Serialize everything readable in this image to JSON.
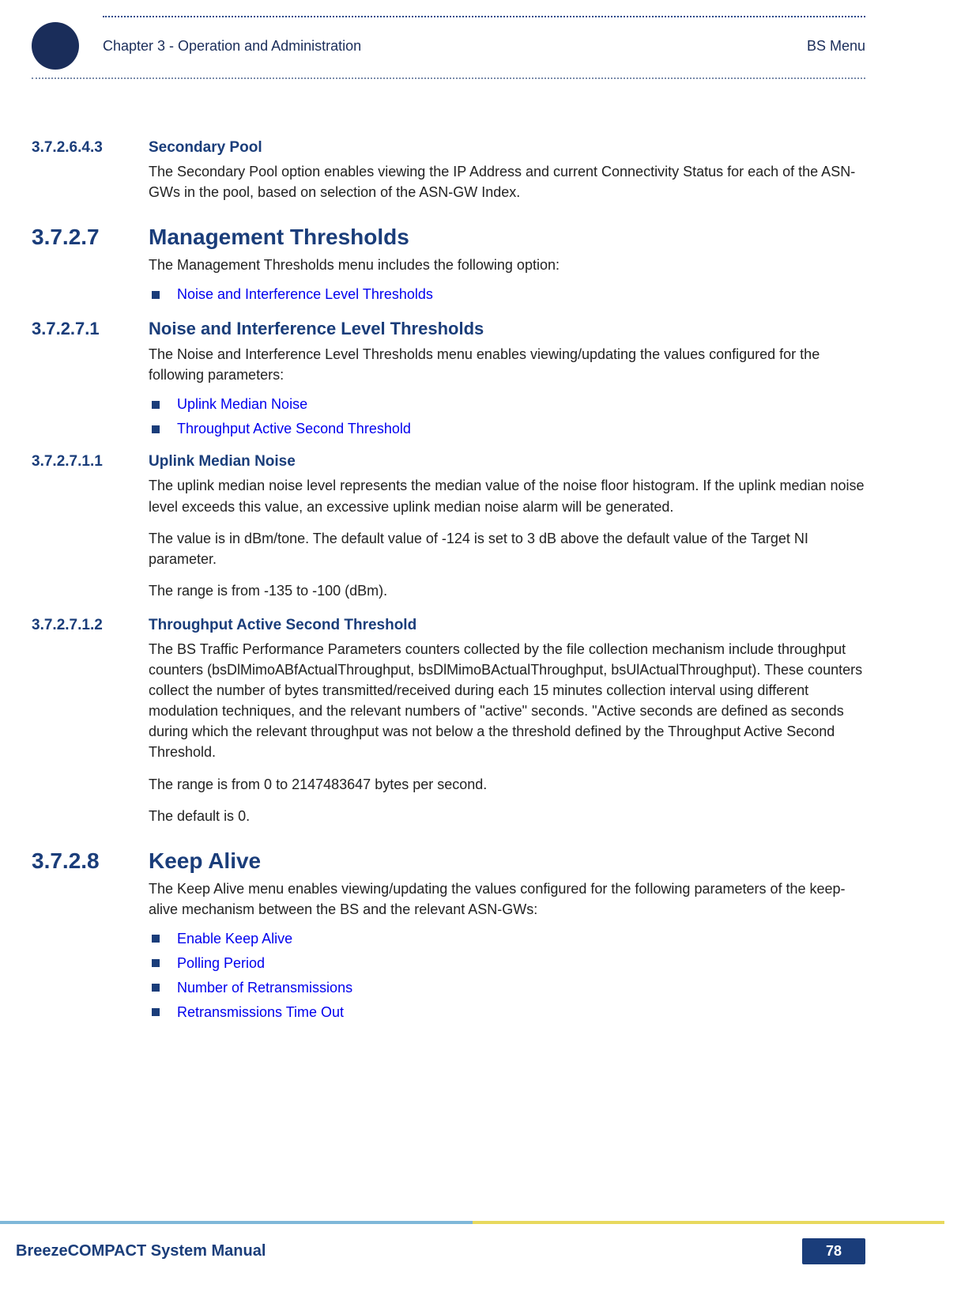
{
  "header": {
    "chapter": "Chapter 3 - Operation and Administration",
    "menu": "BS Menu"
  },
  "sections": {
    "sec_pool": {
      "num": "3.7.2.6.4.3",
      "title": "Secondary Pool",
      "body": "The Secondary Pool option enables viewing the IP Address and current Connectivity Status for each of the ASN-GWs in the pool, based on selection of the ASN-GW Index."
    },
    "mgmt": {
      "num": "3.7.2.7",
      "title": "Management Thresholds",
      "body": "The Management Thresholds menu includes the following option:",
      "bullets": [
        "Noise and Interference Level Thresholds"
      ]
    },
    "noise": {
      "num": "3.7.2.7.1",
      "title": "Noise and Interference Level Thresholds",
      "body": "The Noise and Interference Level Thresholds menu enables viewing/updating the values configured for the following parameters:",
      "bullets": [
        "Uplink Median Noise",
        "Throughput Active Second Threshold"
      ]
    },
    "uplink": {
      "num": "3.7.2.7.1.1",
      "title": "Uplink Median Noise",
      "p1": "The uplink median noise level represents the median value of the noise floor histogram. If the uplink median noise level exceeds this value, an excessive uplink median noise alarm will be generated.",
      "p2": "The value is in dBm/tone. The default value of -124 is set to 3 dB above the default value of the Target NI parameter.",
      "p3": "The range is from -135 to -100 (dBm)."
    },
    "throughput": {
      "num": "3.7.2.7.1.2",
      "title": "Throughput Active Second Threshold",
      "p1": "The BS Traffic Performance Parameters counters collected by the file collection mechanism include throughput counters (bsDlMimoABfActualThroughput, bsDlMimoBActualThroughput, bsUlActualThroughput). These counters collect the number of bytes transmitted/received during each 15 minutes collection interval using different modulation techniques, and the relevant numbers of \"active\" seconds. \"Active seconds are defined as seconds during which the relevant throughput was not below a the threshold defined by the Throughput Active Second Threshold.",
      "p2": "The range is from 0 to 2147483647 bytes per second.",
      "p3": "The default is 0."
    },
    "keepalive": {
      "num": "3.7.2.8",
      "title": "Keep Alive",
      "body": "The Keep Alive menu enables viewing/updating the values configured for the following parameters of the keep-alive mechanism between the BS and the relevant ASN-GWs:",
      "bullets": [
        "Enable Keep Alive",
        "Polling Period",
        "Number of Retransmissions",
        "Retransmissions Time Out"
      ]
    }
  },
  "footer": {
    "title": "BreezeCOMPACT System Manual",
    "page": "78"
  }
}
